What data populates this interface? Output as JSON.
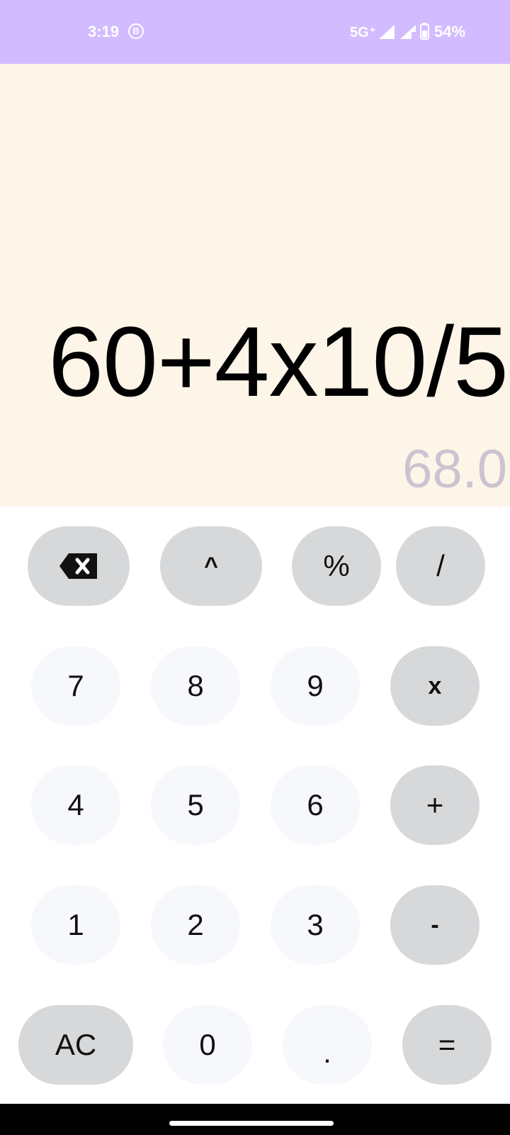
{
  "status_bar": {
    "time": "3:19",
    "notification_icon_letter": "B",
    "network": "5G⁺",
    "battery": "54%"
  },
  "display": {
    "expression": "60+4x10/5",
    "result": "68.0"
  },
  "keys": {
    "backspace": "backspace-icon",
    "power": "^",
    "percent": "%",
    "divide": "/",
    "seven": "7",
    "eight": "8",
    "nine": "9",
    "multiply": "x",
    "four": "4",
    "five": "5",
    "six": "6",
    "plus": "+",
    "one": "1",
    "two": "2",
    "three": "3",
    "minus": "-",
    "clear": "AC",
    "zero": "0",
    "dot": ".",
    "equals": "="
  },
  "colors": {
    "status_bar": "#d2bbff",
    "display_background": "#fdf5e8",
    "result_text": "#cdc3d0",
    "operator_key": "#d7d8da",
    "digit_key": "#f7f8fc"
  }
}
